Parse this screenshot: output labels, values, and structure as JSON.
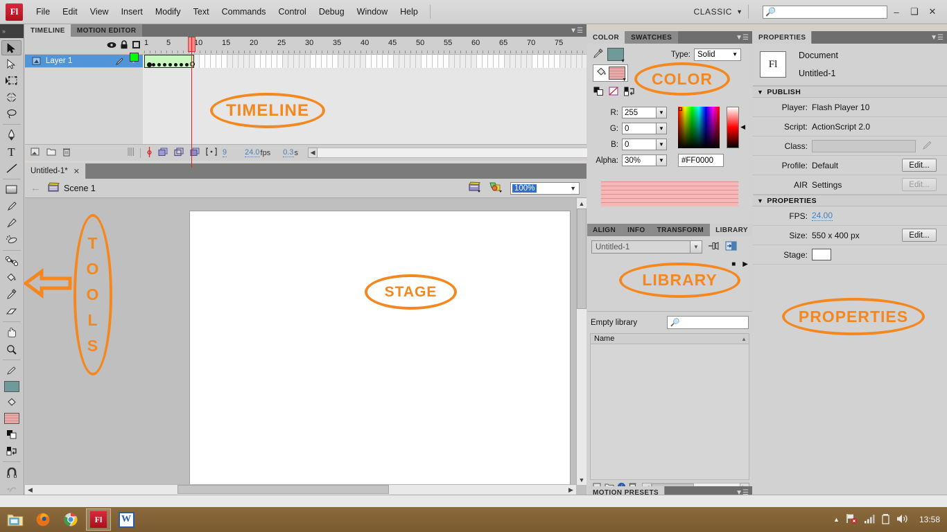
{
  "app": {
    "logo": "Fl",
    "menus": [
      "File",
      "Edit",
      "View",
      "Insert",
      "Modify",
      "Text",
      "Commands",
      "Control",
      "Debug",
      "Window",
      "Help"
    ],
    "workspace": "CLASSIC",
    "search_placeholder": "",
    "search_value": "",
    "window_buttons": {
      "minimize": "–",
      "maximize": "❑",
      "close": "✕"
    }
  },
  "tools": {
    "panel_name": "tools-panel",
    "items": [
      "selection-tool",
      "subselection-tool",
      "free-transform-tool",
      "3d-rotation-tool",
      "lasso-tool",
      "pen-tool",
      "text-tool",
      "line-tool",
      "rectangle-tool",
      "pencil-tool",
      "brush-tool",
      "spray-brush-tool",
      "bone-tool",
      "paint-bucket-tool",
      "eyedropper-tool",
      "eraser-tool",
      "hand-tool",
      "zoom-tool",
      "stroke-color-tool",
      "fill-color-tool",
      "snap-magnet-tool",
      "smooth-tool",
      "straighten-tool"
    ],
    "fill_color": "#6f9a9a",
    "stroke_color": "#e9a8a8"
  },
  "timeline": {
    "tabs": [
      {
        "label": "TIMELINE",
        "active": true
      },
      {
        "label": "MOTION EDITOR",
        "active": false
      }
    ],
    "column_icons": [
      "eye-icon",
      "lock-icon",
      "outline-square-icon"
    ],
    "ruler_numbers": [
      "1",
      "5",
      "10",
      "15",
      "20",
      "25",
      "30",
      "35",
      "40",
      "45",
      "50",
      "55",
      "60",
      "65",
      "70",
      "75"
    ],
    "playhead_frame": 9,
    "layers": [
      {
        "name": "Layer 1",
        "selected": true,
        "color": "#00ff00",
        "keyframe_start": 1,
        "keyframe_end": 9
      }
    ],
    "status": {
      "current_frame": "9",
      "fps": "24.0",
      "fps_suffix": "fps",
      "elapsed": "0.3",
      "elapsed_suffix": "s"
    },
    "footer_buttons": [
      "new-layer-icon",
      "new-folder-icon",
      "delete-layer-icon"
    ],
    "onion_buttons": [
      "center-frame-icon",
      "onion-skin-icon",
      "onion-skin-outlines-icon",
      "edit-multiple-frames-icon",
      "modify-onion-markers-icon"
    ]
  },
  "document": {
    "tab_label": "Untitled-1*",
    "tab_close": "✕",
    "scene_name": "Scene 1",
    "zoom": "100%",
    "edit_scene_icon": "edit-scene-icon",
    "edit_symbols_icon": "edit-symbols-icon",
    "back_arrow_icon": "back-arrow-icon"
  },
  "color_panel": {
    "tabs": [
      {
        "label": "COLOR",
        "active": true
      },
      {
        "label": "SWATCHES",
        "active": false
      }
    ],
    "type_label": "Type:",
    "type_value": "Solid",
    "fields": [
      {
        "label": "R:",
        "value": "255"
      },
      {
        "label": "G:",
        "value": "0"
      },
      {
        "label": "B:",
        "value": "0"
      },
      {
        "label": "Alpha:",
        "value": "30%"
      }
    ],
    "hex": "#FF0000",
    "icons": [
      "eyedropper-icon",
      "stroke-color-icon",
      "fill-color-icon",
      "black-white-icon",
      "no-color-icon",
      "swap-colors-icon"
    ]
  },
  "library_panel": {
    "tabs": [
      {
        "label": "ALIGN",
        "active": false
      },
      {
        "label": "INFO",
        "active": false
      },
      {
        "label": "TRANSFORM",
        "active": false
      },
      {
        "label": "LIBRARY",
        "active": true
      }
    ],
    "document_select": "Untitled-1",
    "pin_icon": "pin-icon",
    "new-library-icon": "new-library-panel-icon",
    "stop_icon": "■",
    "play_icon": "▶",
    "status_text": "Empty library",
    "search_placeholder": "",
    "column_header": "Name",
    "items": [],
    "footer_buttons": [
      "new-symbol-icon",
      "new-folder-icon",
      "properties-icon",
      "delete-icon"
    ]
  },
  "motion_presets": {
    "label": "MOTION PRESETS"
  },
  "properties_panel": {
    "tab_label": "PROPERTIES",
    "doc_icon": "Fl",
    "type": "Document",
    "name": "Untitled-1",
    "sections": [
      {
        "title": "PUBLISH",
        "rows": [
          {
            "label": "Player:",
            "value": "Flash Player 10",
            "button": null
          },
          {
            "label": "Script:",
            "value": "ActionScript 2.0",
            "button": null
          },
          {
            "label": "Class:",
            "value": "",
            "button": null,
            "input": true,
            "icon": "pencil-icon"
          },
          {
            "label": "Profile:",
            "value": "Default",
            "button": "Edit...",
            "button_disabled": false
          },
          {
            "label": "AIR",
            "value": "Settings",
            "button": "Edit...",
            "button_disabled": true
          }
        ]
      },
      {
        "title": "PROPERTIES",
        "rows": [
          {
            "label": "FPS:",
            "value": "24.00",
            "link": true
          },
          {
            "label": "Size:",
            "value": "550 x 400 px",
            "button": "Edit..."
          },
          {
            "label": "Stage:",
            "value": "",
            "swatch": "#ffffff"
          }
        ]
      }
    ]
  },
  "annotations": {
    "color": "#f5871f",
    "items": [
      {
        "name": "timeline-annotation",
        "text": "TIMELINE"
      },
      {
        "name": "stage-annotation",
        "text": "STAGE"
      },
      {
        "name": "color-annotation",
        "text": "COLOR"
      },
      {
        "name": "library-annotation",
        "text": "LIBRARY"
      },
      {
        "name": "properties-annotation",
        "text": "PROPERTIES"
      },
      {
        "name": "tools-annotation",
        "text": "TOOLS",
        "letters": [
          "T",
          "O",
          "O",
          "L",
          "S"
        ]
      }
    ]
  },
  "taskbar": {
    "items": [
      "explorer-icon",
      "firefox-icon",
      "chrome-icon",
      "flash-icon",
      "word-icon"
    ],
    "active_item": "flash-icon",
    "tray_icons": [
      "show-hidden-icons-icon",
      "network-error-icon",
      "signal-icon",
      "battery-icon",
      "volume-icon"
    ],
    "clock": "13:58"
  }
}
